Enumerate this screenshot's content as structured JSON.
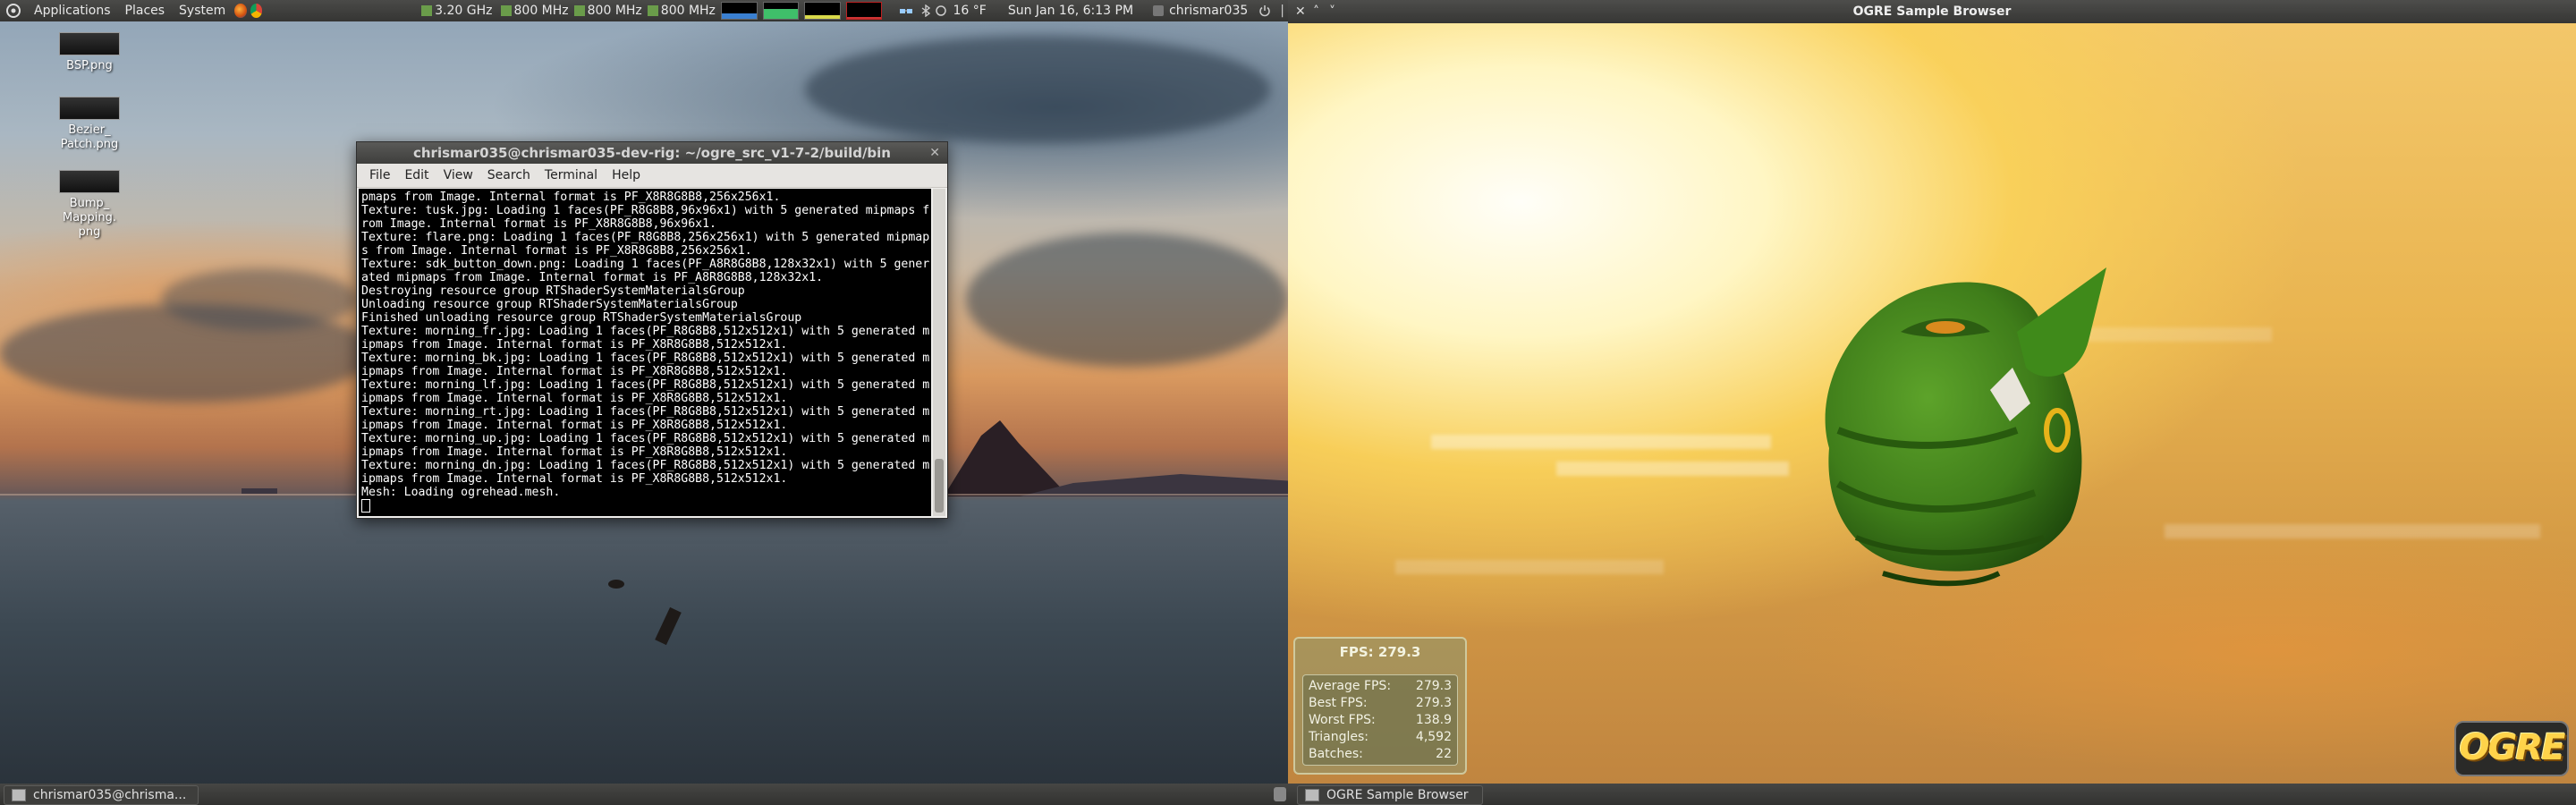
{
  "top_panel": {
    "menus": [
      "Applications",
      "Places",
      "System"
    ],
    "cpu_freqs": [
      "3.20 GHz",
      "800 MHz",
      "800 MHz",
      "800 MHz"
    ],
    "weather": "16 °F",
    "datetime": "Sun Jan 16,  6:13 PM",
    "user": "chrismar035"
  },
  "desktop_icons": [
    {
      "label": "BSP.png"
    },
    {
      "label": "Bezier_ Patch.png"
    },
    {
      "label": "Bump_ Mapping. png"
    }
  ],
  "terminal": {
    "title": "chrismar035@chrismar035-dev-rig: ~/ogre_src_v1-7-2/build/bin",
    "menus": [
      "File",
      "Edit",
      "View",
      "Search",
      "Terminal",
      "Help"
    ],
    "lines": [
      "pmaps from Image. Internal format is PF_X8R8G8B8,256x256x1.",
      "Texture: tusk.jpg: Loading 1 faces(PF_R8G8B8,96x96x1) with 5 generated mipmaps f",
      "rom Image. Internal format is PF_X8R8G8B8,96x96x1.",
      "Texture: flare.png: Loading 1 faces(PF_R8G8B8,256x256x1) with 5 generated mipmap",
      "s from Image. Internal format is PF_X8R8G8B8,256x256x1.",
      "Texture: sdk_button_down.png: Loading 1 faces(PF_A8R8G8B8,128x32x1) with 5 gener",
      "ated mipmaps from Image. Internal format is PF_A8R8G8B8,128x32x1.",
      "Destroying resource group RTShaderSystemMaterialsGroup",
      "Unloading resource group RTShaderSystemMaterialsGroup",
      "Finished unloading resource group RTShaderSystemMaterialsGroup",
      "Texture: morning_fr.jpg: Loading 1 faces(PF_R8G8B8,512x512x1) with 5 generated m",
      "ipmaps from Image. Internal format is PF_X8R8G8B8,512x512x1.",
      "Texture: morning_bk.jpg: Loading 1 faces(PF_R8G8B8,512x512x1) with 5 generated m",
      "ipmaps from Image. Internal format is PF_X8R8G8B8,512x512x1.",
      "Texture: morning_lf.jpg: Loading 1 faces(PF_R8G8B8,512x512x1) with 5 generated m",
      "ipmaps from Image. Internal format is PF_X8R8G8B8,512x512x1.",
      "Texture: morning_rt.jpg: Loading 1 faces(PF_R8G8B8,512x512x1) with 5 generated m",
      "ipmaps from Image. Internal format is PF_X8R8G8B8,512x512x1.",
      "Texture: morning_up.jpg: Loading 1 faces(PF_R8G8B8,512x512x1) with 5 generated m",
      "ipmaps from Image. Internal format is PF_X8R8G8B8,512x512x1.",
      "Texture: morning_dn.jpg: Loading 1 faces(PF_R8G8B8,512x512x1) with 5 generated m",
      "ipmaps from Image. Internal format is PF_X8R8G8B8,512x512x1.",
      "Mesh: Loading ogrehead.mesh."
    ]
  },
  "ogre_window": {
    "title": "OGRE Sample Browser",
    "fps_main": "FPS: 279.3",
    "stats": [
      {
        "label": "Average FPS:",
        "value": "279.3"
      },
      {
        "label": "Best FPS:",
        "value": "279.3"
      },
      {
        "label": "Worst FPS:",
        "value": "138.9"
      },
      {
        "label": "Triangles:",
        "value": "4,592"
      },
      {
        "label": "Batches:",
        "value": "22"
      }
    ],
    "logo": "OGRE"
  },
  "taskbar": {
    "left_task": "chrismar035@chrisma...",
    "right_task": "OGRE Sample Browser"
  },
  "colors": {
    "ogre_skin": "#3f7d1a",
    "logo_yellow": "#ffd34a",
    "panel_bg": "#3e3e3c"
  }
}
